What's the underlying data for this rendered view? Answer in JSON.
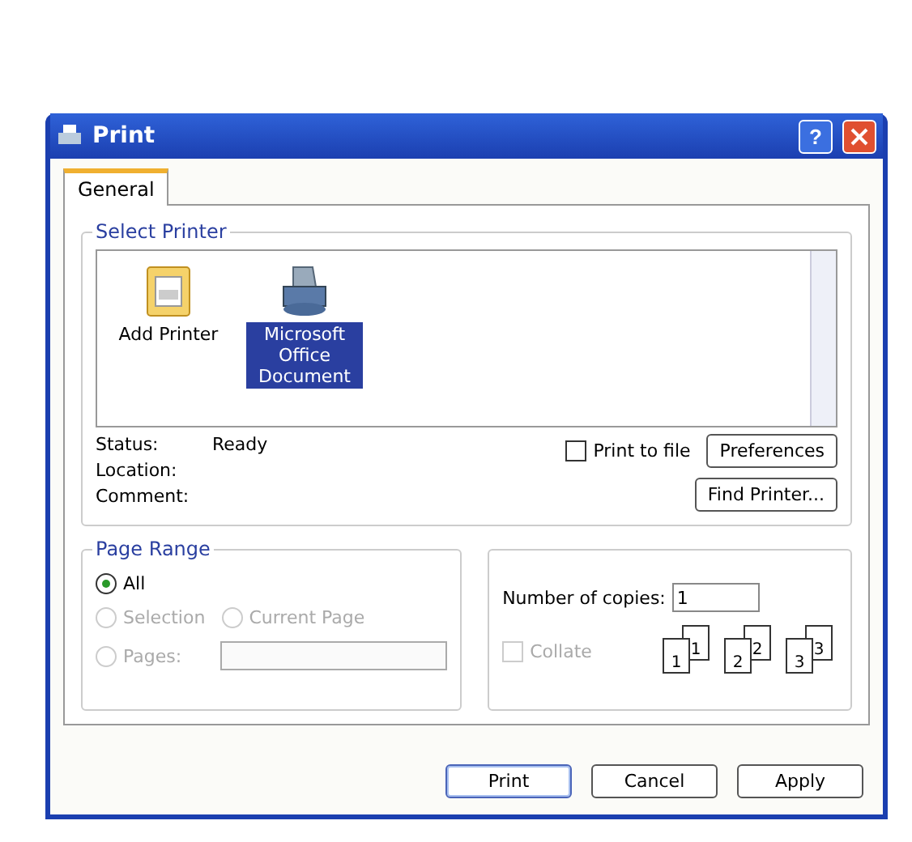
{
  "window": {
    "title": "Print",
    "help": "?"
  },
  "tabs": [
    {
      "label": "General",
      "selected": true
    }
  ],
  "select_printer": {
    "title": "Select Printer",
    "printers": [
      {
        "name": "Add Printer",
        "kind": "add",
        "selected": false
      },
      {
        "name": "Microsoft Office Document",
        "kind": "printer",
        "selected": true
      }
    ]
  },
  "info": [
    {
      "label": "Status:",
      "value": "Ready"
    },
    {
      "label": "Location:"
    },
    {
      "label": "Comment:"
    }
  ],
  "print_to_file": {
    "label": "Print to file",
    "checked": false
  },
  "printer_buttons": [
    "Preferences",
    "Find Printer..."
  ],
  "page_range": {
    "title": "Page Range",
    "options": [
      {
        "label": "All",
        "selected": true,
        "disabled": false
      },
      {
        "label": "Selection",
        "selected": false,
        "disabled": true
      },
      {
        "label": "Current Page",
        "selected": false,
        "disabled": true
      },
      {
        "label": "Pages:",
        "selected": false,
        "disabled": true
      }
    ]
  },
  "copies": {
    "label": "Number of copies:",
    "value": "1",
    "collate": {
      "label": "Collate",
      "checked": false,
      "disabled": true
    },
    "collate_sets": [
      {
        "front": "1",
        "back": "1"
      },
      {
        "front": "2",
        "back": "2"
      },
      {
        "front": "3",
        "back": "3"
      }
    ]
  },
  "buttons": [
    {
      "label": "Print",
      "default": true
    },
    {
      "label": "Cancel",
      "default": false
    },
    {
      "label": "Apply",
      "default": false
    }
  ]
}
